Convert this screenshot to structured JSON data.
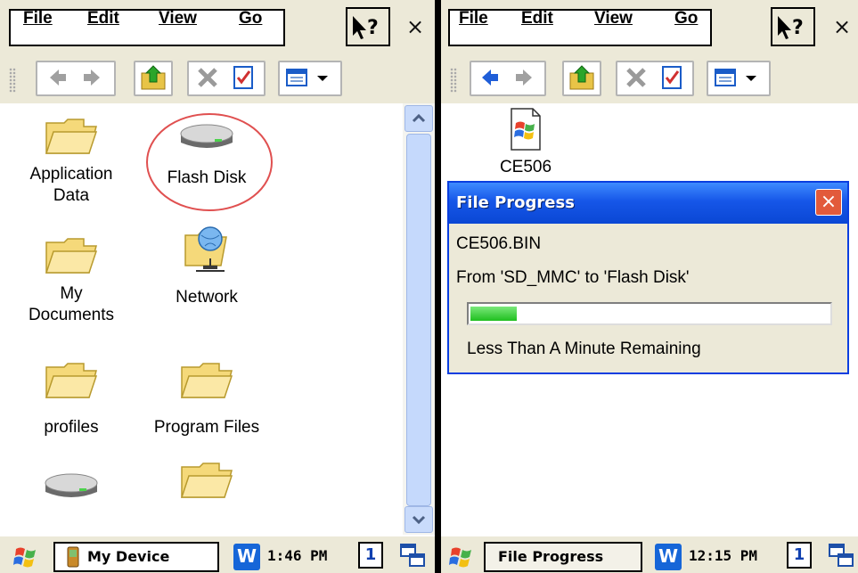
{
  "left": {
    "menu": {
      "file": "File",
      "edit": "Edit",
      "view": "View",
      "go": "Go"
    },
    "help_icon": "whats-this-help-icon",
    "close_glyph": "×",
    "files": [
      {
        "name": "Application\nData",
        "icon": "folder-icon"
      },
      {
        "name": "Flash Disk",
        "icon": "flash-disk-drive-icon"
      },
      {
        "name": "My\nDocuments",
        "icon": "folder-icon"
      },
      {
        "name": "Network",
        "icon": "network-icon"
      },
      {
        "name": "profiles",
        "icon": "folder-icon"
      },
      {
        "name": "Program Files",
        "icon": "folder-icon"
      },
      {
        "name": "",
        "icon": "drive-icon"
      },
      {
        "name": "",
        "icon": "folder-icon"
      }
    ],
    "taskbar": {
      "task": "My Device",
      "time": "1:46 PM",
      "desktop_num": "1"
    }
  },
  "right": {
    "menu": {
      "file": "File",
      "edit": "Edit",
      "view": "View",
      "go": "Go"
    },
    "close_glyph": "×",
    "file": {
      "name": "CE506",
      "icon": "windows-binary-file-icon"
    },
    "taskbar": {
      "task": "File Progress",
      "time": "12:15 PM",
      "desktop_num": "1"
    }
  },
  "dialog": {
    "title": "File Progress",
    "close_glyph": "×",
    "filename": "CE506.BIN",
    "from_to": "From 'SD_MMC' to 'Flash Disk'",
    "progress_fraction": 0.13,
    "remaining": "Less Than A Minute Remaining"
  },
  "colors": {
    "highlight_circle": "#e05050",
    "dialog_title": "#0a47d4",
    "progress_fill": "#1fbf1f"
  }
}
